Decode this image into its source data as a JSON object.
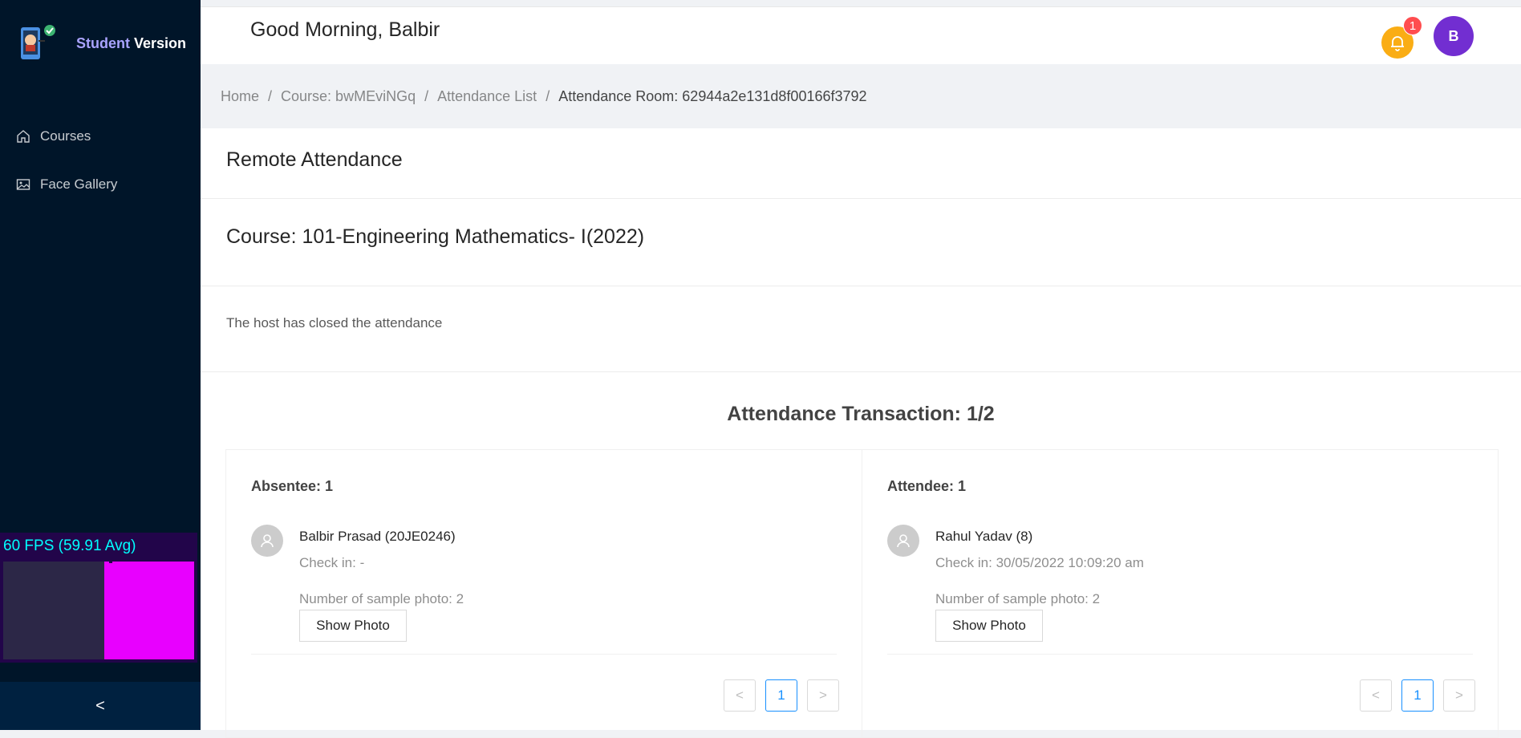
{
  "app": {
    "brand_student": "Student",
    "brand_version": "Version"
  },
  "sidebar": {
    "items": [
      {
        "label": "Courses",
        "icon": "home-icon"
      },
      {
        "label": "Face Gallery",
        "icon": "image-icon"
      }
    ],
    "collapse_glyph": "<"
  },
  "fps_meter": {
    "text": "60 FPS (59.91 Avg)"
  },
  "header": {
    "greeting": "Good Morning, Balbir",
    "notification_count": "1",
    "avatar_initial": "B"
  },
  "breadcrumb": [
    "Home",
    "Course: bwMEviNGq",
    "Attendance List",
    "Attendance Room: 62944a2e131d8f00166f3792"
  ],
  "main": {
    "page_title": "Remote Attendance",
    "course_title": "Course: 101-Engineering Mathematics- I(2022)",
    "status_text": "The host has closed the attendance",
    "transaction_title": "Attendance Transaction: 1/2"
  },
  "absentee": {
    "heading": "Absentee: 1",
    "name": "Balbir Prasad (20JE0246)",
    "check_in": "Check in: -",
    "samples": "Number of sample photo: 2",
    "button": "Show Photo",
    "page": "1"
  },
  "attendee": {
    "heading": "Attendee: 1",
    "name": "Rahul Yadav (8)",
    "check_in": "Check in: 30/05/2022 10:09:20 am",
    "samples": "Number of sample photo: 2",
    "button": "Show Photo",
    "page": "1"
  },
  "colors": {
    "sidebar_bg": "#001529",
    "accent": "#1890ff",
    "bell": "#faad14",
    "avatar": "#722ed1",
    "badge": "#ff4d4f"
  }
}
